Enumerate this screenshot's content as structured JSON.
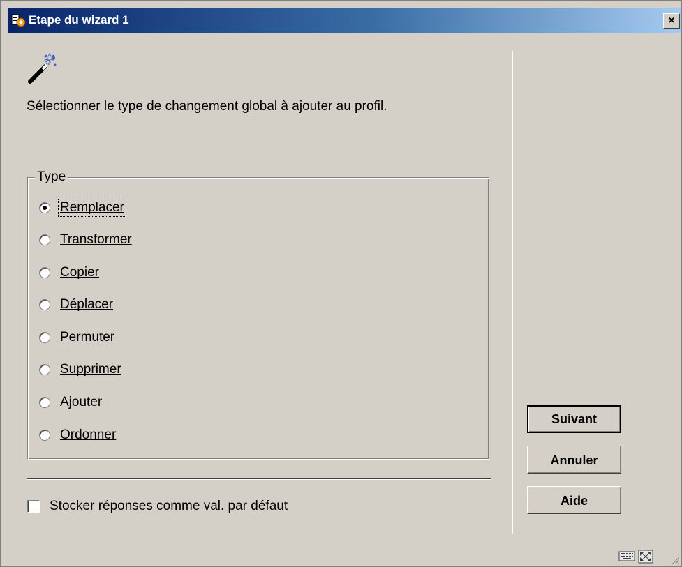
{
  "window": {
    "title": "Etape du wizard 1",
    "close_label": "×"
  },
  "instruction": "Sélectionner le type de changement global à ajouter au profil.",
  "type_group": {
    "legend": "Type",
    "selected": "Remplacer",
    "options": [
      {
        "label": "Remplacer",
        "checked": true
      },
      {
        "label": "Transformer",
        "checked": false
      },
      {
        "label": "Copier",
        "checked": false
      },
      {
        "label": "Déplacer",
        "checked": false
      },
      {
        "label": "Permuter",
        "checked": false
      },
      {
        "label": "Supprimer",
        "checked": false
      },
      {
        "label": "Ajouter",
        "checked": false
      },
      {
        "label": "Ordonner",
        "checked": false
      }
    ]
  },
  "store_defaults": {
    "label": "Stocker réponses comme val. par défaut",
    "checked": false
  },
  "buttons": {
    "next": "Suivant",
    "cancel": "Annuler",
    "help": "Aide"
  },
  "colors": {
    "titlebar_start": "#0a246a",
    "titlebar_end": "#a6caf0",
    "face": "#d4d0c8"
  },
  "icons": [
    "app-icon",
    "magic-wand-icon",
    "close-icon",
    "keyboard-icon",
    "resize-icon",
    "size-grip-icon"
  ]
}
